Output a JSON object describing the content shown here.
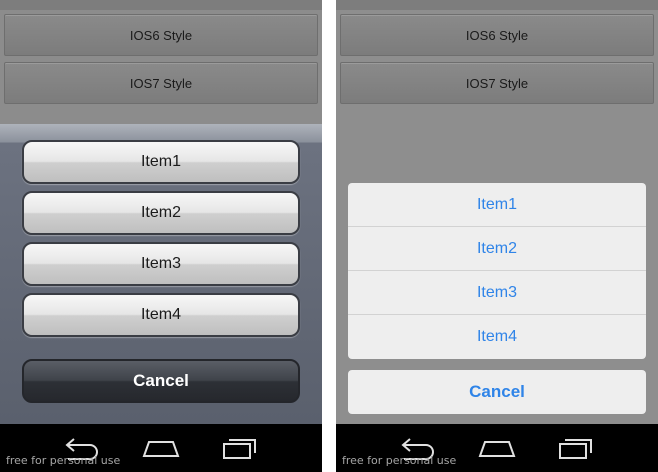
{
  "left": {
    "buttons": {
      "ios6": "IOS6 Style",
      "ios7": "IOS7 Style"
    },
    "sheet": {
      "items": [
        "Item1",
        "Item2",
        "Item3",
        "Item4"
      ],
      "cancel": "Cancel"
    },
    "watermark": "free for personal use"
  },
  "right": {
    "buttons": {
      "ios6": "IOS6 Style",
      "ios7": "IOS7 Style"
    },
    "sheet": {
      "items": [
        "Item1",
        "Item2",
        "Item3",
        "Item4"
      ],
      "cancel": "Cancel"
    },
    "watermark": "free for personal use"
  },
  "nav": {
    "icons": [
      "back-icon",
      "home-icon",
      "recent-apps-icon"
    ]
  },
  "colors": {
    "ios7_accent": "#2f84e8",
    "ios6_cancel_bg": "#2d3036",
    "nav_bg": "#000000"
  }
}
